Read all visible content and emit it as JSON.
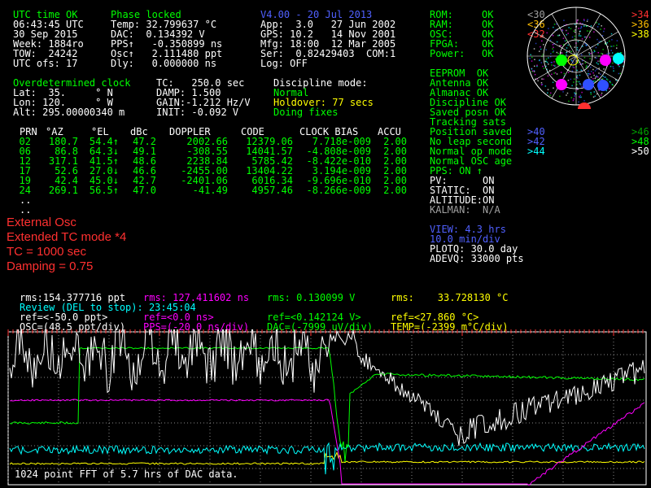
{
  "status": {
    "utc_ok": "UTC time OK",
    "phase": "Phase locked",
    "time": "06:43:45 UTC",
    "date": "30 Sep 2015",
    "week": "Week: 1884ro",
    "tow": "TOW:  24242",
    "utc_ofs": "UTC ofs: 17",
    "temp": "Temp: 32.799637 °C",
    "dac": "DAC:  0.134392 V",
    "pps": "PPS↑   -0.350899 ns",
    "osc": "Osc↑   2.111480 ppt",
    "dly": "Dly:   0.000000 ns",
    "version": "V4.00 - 20 Jul 2013",
    "app": "App:  3.0   27 Jun 2002",
    "gps": "GPS: 10.2   14 Nov 2001",
    "mfg": "Mfg: 18:00  12 Mar 2005",
    "ser": "Ser:  0.82429403  COM:1",
    "log": "Log: OFF"
  },
  "health": [
    {
      "label": "ROM:",
      "value": "OK"
    },
    {
      "label": "RAM:",
      "value": "OK"
    },
    {
      "label": "OSC:",
      "value": "OK"
    },
    {
      "label": "FPGA:",
      "value": "OK"
    },
    {
      "label": "Power:",
      "value": "OK"
    }
  ],
  "health2": [
    "EEPROM  OK",
    "Antenna OK",
    "Almanac OK",
    "Discipline OK",
    "Saved posn OK",
    "Tracking sats",
    "Position saved",
    "No leap second",
    "Normal op mode",
    "Normal OSC age",
    "PPS: ON ↑"
  ],
  "pos_status": [
    "PV:      ON",
    "STATIC:  ON",
    "ALTITUDE:ON"
  ],
  "kalman": "KALMAN:  N/A",
  "view": {
    "line1": "VIEW: 4.3 hrs",
    "line2": "10.0 min/div",
    "plotq": "PLOTQ: 30.0 day",
    "adevq": "ADEVQ: 33000 pts"
  },
  "elev_left": [
    {
      "t": "<30",
      "c": "#a0a0a0"
    },
    {
      "t": "<36",
      "c": "#ffbf00"
    },
    {
      "t": "<32",
      "c": "#ff3030"
    }
  ],
  "elev_right": [
    {
      "t": ">34",
      "c": "#ff3030"
    },
    {
      "t": ">36",
      "c": "#ffbf00"
    },
    {
      "t": ">38",
      "c": "#ffff00"
    }
  ],
  "elev_left2": [
    {
      "t": ">40",
      "c": "#5060ff"
    },
    {
      "t": ">42",
      "c": "#5060ff"
    },
    {
      "t": ">44",
      "c": "#00ffff"
    }
  ],
  "elev_right2": [
    {
      "t": ">46",
      "c": "#00a000"
    },
    {
      "t": ">48",
      "c": "#00ff00"
    },
    {
      "t": ">50",
      "c": "#ffffff"
    }
  ],
  "clock": {
    "title": "Overdetermined clock",
    "lat": "Lat:  35.     ° N",
    "lon": "Lon: 120.     ° W",
    "alt": "Alt: 295.00000340 m",
    "tc": "TC:   250.0 sec",
    "damp": "DAMP: 1.500",
    "gain": "GAIN:-1.212 Hz/V",
    "init": "INIT: -0.092 V",
    "disc_label": "Discipline mode:",
    "disc_mode": "Normal",
    "holdover": "Holdover: 77 secs",
    "doing": "Doing fixes"
  },
  "sat_table": {
    "headers": [
      "PRN",
      "°AZ",
      "°EL",
      "dBc",
      "DOPPLER",
      "CODE",
      "CLOCK BIAS",
      "ACCU"
    ],
    "rows": [
      [
        "02",
        "180.7",
        "54.4↑",
        "47.2",
        "2002.66",
        "12379.06",
        "7.718e-009",
        "2.00"
      ],
      [
        "06",
        "86.8",
        "64.3↓",
        "49.1",
        "-308.55",
        "14041.57",
        "-4.808e-009",
        "2.00"
      ],
      [
        "12",
        "317.1",
        "41.5↑",
        "48.6",
        "2238.84",
        "5785.42",
        "-8.422e-010",
        "2.00"
      ],
      [
        "17",
        "52.6",
        "27.0↓",
        "46.6",
        "-2455.00",
        "13404.22",
        "3.194e-009",
        "2.00"
      ],
      [
        "19",
        "42.4",
        "45.0↓",
        "42.7",
        "-2401.06",
        "6016.34",
        "-9.696e-010",
        "2.00"
      ],
      [
        "24",
        "269.1",
        "56.5↑",
        "47.0",
        "-41.49",
        "4957.46",
        "-8.266e-009",
        "2.00"
      ]
    ],
    "dots": [
      "..",
      ".."
    ]
  },
  "notes": [
    "External Osc",
    "Extended TC mode *4",
    "TC = 1000 sec",
    "Damping = 0.75"
  ],
  "rms": {
    "osc": "rms:154.377716 ppt",
    "pps": "rms: 127.411602 ns",
    "dac": "rms: 0.130099 V",
    "temp": "rms:    33.728130 °C"
  },
  "review": "Review (DEL to stop): 23:45:04",
  "refs": {
    "osc": "ref=<-50.0 ppt>",
    "pps": "ref=<0.0 ns>",
    "dac": "ref=<0.142124 V>",
    "temp": "ref=<27.860 °C>"
  },
  "scales": {
    "osc": "OSC=(48.5 ppt/div)",
    "pps": "PPS=(-20.0 ns/div)",
    "dac": "DAC=(-7999 uV/div)",
    "temp": "TEMP=(-2399 m°C/div)"
  },
  "fft_caption": "1024 point FFT of 5.7 hrs of DAC data.",
  "colors": {
    "green": "#00ff00",
    "yellow": "#ffff00",
    "cyan": "#00ffff",
    "magenta": "#ff00ff",
    "red": "#ff3030",
    "white": "#ffffff"
  }
}
